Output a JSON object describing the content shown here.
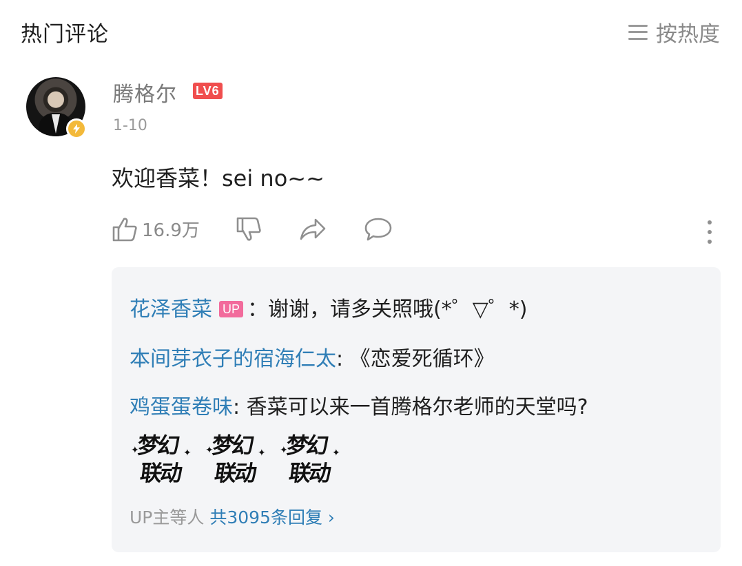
{
  "header": {
    "title": "热门评论",
    "sort_label": "按热度"
  },
  "comment": {
    "username": "腾格尔",
    "level": "LV6",
    "date": "1-10",
    "text": "欢迎香菜！sei no~~",
    "like_count": "16.9万"
  },
  "replies": {
    "items": [
      {
        "author": "花泽香菜",
        "badge": "UP",
        "separator": "：",
        "text": "谢谢，请多关照哦(*゜▽゜*)"
      },
      {
        "author": "本间芽衣子的宿海仁太",
        "separator": ": ",
        "text": "《恋爱死循环》"
      },
      {
        "author": "鸡蛋蛋卷味",
        "separator": ": ",
        "text": "香菜可以来一首腾格尔老师的天堂吗?"
      }
    ],
    "sticker": {
      "line1": "梦幻",
      "line2": "联动"
    },
    "summary_prefix": "UP主等人",
    "summary_link": "共3095条回复",
    "summary_chevron": "›"
  },
  "colors": {
    "link_blue": "#2f7eb6",
    "level_red": "#f04e4e",
    "up_pink": "#f26b9c",
    "verify_gold": "#f3b93a"
  },
  "icons": [
    "sort-icon",
    "thumbs-up-icon",
    "thumbs-down-icon",
    "share-icon",
    "comment-icon",
    "more-vertical-icon",
    "lightning-icon"
  ]
}
